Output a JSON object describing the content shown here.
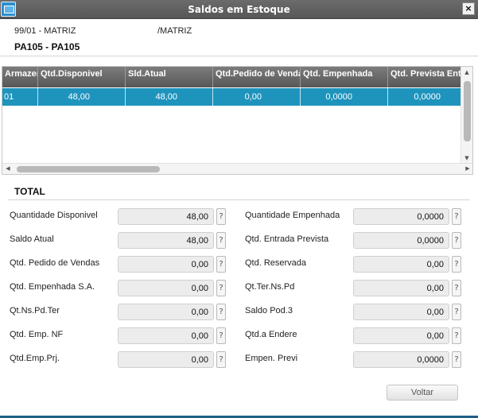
{
  "window": {
    "title": "Saldos em Estoque",
    "close_label": "×"
  },
  "header": {
    "branch": "99/01 - MATRIZ",
    "branch_name": "/MATRIZ",
    "product": "PA105 - PA105"
  },
  "grid": {
    "columns": [
      "Armazem",
      "Qtd.Disponivel",
      "Sld.Atual",
      "Qtd.Pedido de Vendas",
      "Qtd. Empenhada",
      "Qtd. Prevista Entrada"
    ],
    "rows": [
      [
        "01",
        "48,00",
        "48,00",
        "0,00",
        "0,0000",
        "0,0000"
      ]
    ],
    "scroll_up": "▲",
    "scroll_down": "▼",
    "scroll_left": "◀",
    "scroll_right": "▶"
  },
  "total": {
    "title": "TOTAL",
    "help_label": "?",
    "left_fields": [
      {
        "label": "Quantidade Disponivel",
        "value": "48,00"
      },
      {
        "label": "Saldo Atual",
        "value": "48,00"
      },
      {
        "label": "Qtd. Pedido de Vendas",
        "value": "0,00"
      },
      {
        "label": "Qtd. Empenhada S.A.",
        "value": "0,00"
      },
      {
        "label": "Qt.Ns.Pd.Ter",
        "value": "0,00"
      },
      {
        "label": "Qtd. Emp. NF",
        "value": "0,00"
      },
      {
        "label": "Qtd.Emp.Prj.",
        "value": "0,00"
      }
    ],
    "right_fields": [
      {
        "label": "Quantidade Empenhada",
        "value": "0,0000"
      },
      {
        "label": "Qtd. Entrada Prevista",
        "value": "0,0000"
      },
      {
        "label": "Qtd. Reservada",
        "value": "0,00"
      },
      {
        "label": "Qt.Ter.Ns.Pd",
        "value": "0,00"
      },
      {
        "label": "Saldo Pod.3",
        "value": "0,00"
      },
      {
        "label": "Qtd.a Endere",
        "value": "0,00"
      },
      {
        "label": "Empen. Previ",
        "value": "0,0000"
      }
    ]
  },
  "footer": {
    "back_label": "Voltar"
  }
}
